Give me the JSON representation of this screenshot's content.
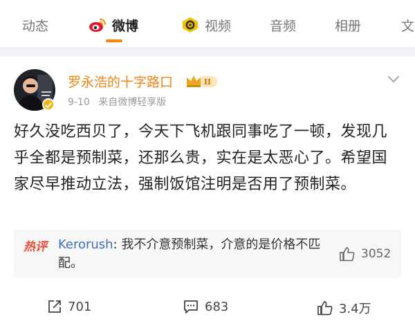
{
  "tabs": [
    {
      "label": "动态",
      "active": false
    },
    {
      "label": "微博",
      "active": true,
      "icon": "weibo-logo-icon"
    },
    {
      "label": "视频",
      "active": false,
      "icon": "video-camera-icon"
    },
    {
      "label": "音频",
      "active": false
    },
    {
      "label": "相册",
      "active": false
    },
    {
      "label": "文",
      "active": false
    }
  ],
  "colors": {
    "accent": "#ff8200",
    "author": "#f08513",
    "link": "#3e6fb8",
    "hot": "#e64c3c"
  },
  "post": {
    "author": "罗永浩的十字路口",
    "date": "9-10",
    "source": "来自微博轻享版",
    "content": "好久没吃西贝了，今天下飞机跟同事吃了一顿，发现几乎全都是预制菜，还那么贵，实在是太恶心了。希望国家尽早推动立法，强制饭馆注明是否用了预制菜。"
  },
  "hot_comment": {
    "tag": "热评",
    "user": "Kerorush",
    "text": ": 我不介意预制菜，介意的是价格不匹配。",
    "likes": "3052"
  },
  "actions": {
    "reposts": "701",
    "comments": "683",
    "likes": "3.4万"
  }
}
